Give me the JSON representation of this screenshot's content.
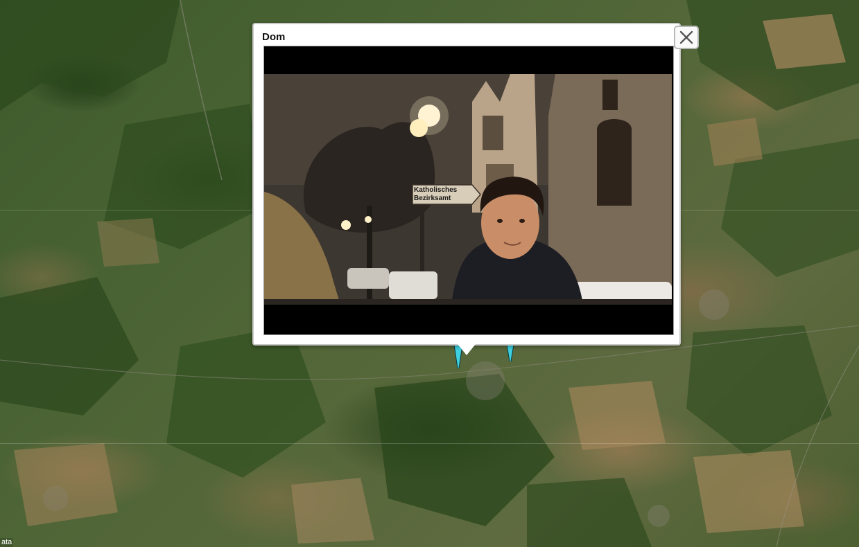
{
  "map": {
    "attribution": "ata",
    "markers": [
      {
        "name": "marker-left",
        "color": "#3fd0e0"
      },
      {
        "name": "marker-right",
        "color": "#3fd0e0"
      }
    ]
  },
  "popup": {
    "title": "Dom",
    "video": {
      "sign_line1": "Katholisches",
      "sign_line2": "Bezirksamt"
    },
    "close_icon": "close-icon"
  },
  "colors": {
    "popup_bg": "#ffffff",
    "popup_border": "#c9c9c9",
    "marker": "#3fd0e0",
    "video_bg": "#000000"
  }
}
